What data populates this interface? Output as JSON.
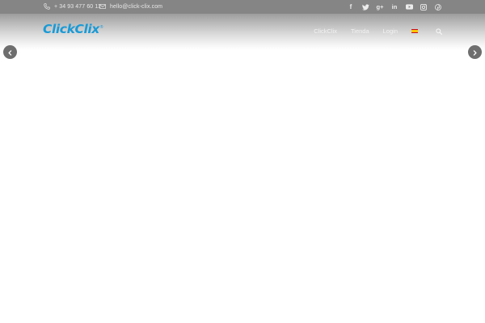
{
  "topbar": {
    "phone": "+ 34 93 477 60 11",
    "email": "hello@click-clix.com",
    "icons": {
      "phone": "phone-icon",
      "email": "envelope-icon"
    },
    "socials": [
      "facebook-icon",
      "twitter-icon",
      "google-plus-icon",
      "linkedin-icon",
      "youtube-icon",
      "instagram-icon",
      "pinterest-icon"
    ]
  },
  "header": {
    "logo": "ClickClix",
    "logo_mark": "®",
    "nav": [
      "ClickClix",
      "Tienda",
      "Login"
    ],
    "language_flag": "spain-flag-icon",
    "search_icon": "search-icon"
  },
  "slider": {
    "prev_icon": "chevron-left-icon",
    "next_icon": "chevron-right-icon"
  },
  "colors": {
    "brand": "#1a9ad6",
    "topbar": "#858585",
    "arrow_bg": "#6e6e6e"
  }
}
